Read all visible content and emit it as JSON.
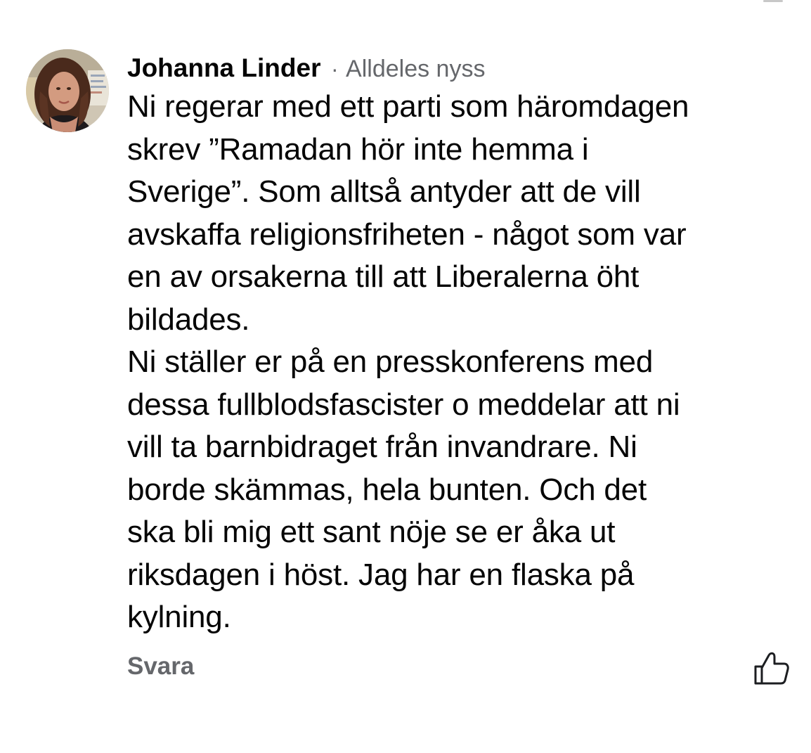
{
  "comment": {
    "author": "Johanna Linder",
    "separator": "·",
    "timestamp": "Alldeles nyss",
    "text": "Ni regerar med ett parti som häromdagen\nskrev ”Ramadan hör inte hemma i\nSverige”. Som alltså antyder att de vill\navskaffa religionsfriheten - något som var\nen av orsakerna till att Liberalerna öht\nbildades.\nNi ställer er på en presskonferens med\ndessa fullblodsfascister o meddelar att ni\nvill ta barnbidraget från invandrare. Ni\nborde skämmas, hela bunten. Och det\nska bli mig ett sant nöje se er åka ut\nriksdagen i höst. Jag har en flaska på\nkylning.",
    "reply_label": "Svara",
    "like_icon": "thumbs-up-icon",
    "avatar_icon": "profile-photo"
  },
  "colors": {
    "text": "#050505",
    "secondary_text": "#65676b",
    "background": "#ffffff"
  }
}
